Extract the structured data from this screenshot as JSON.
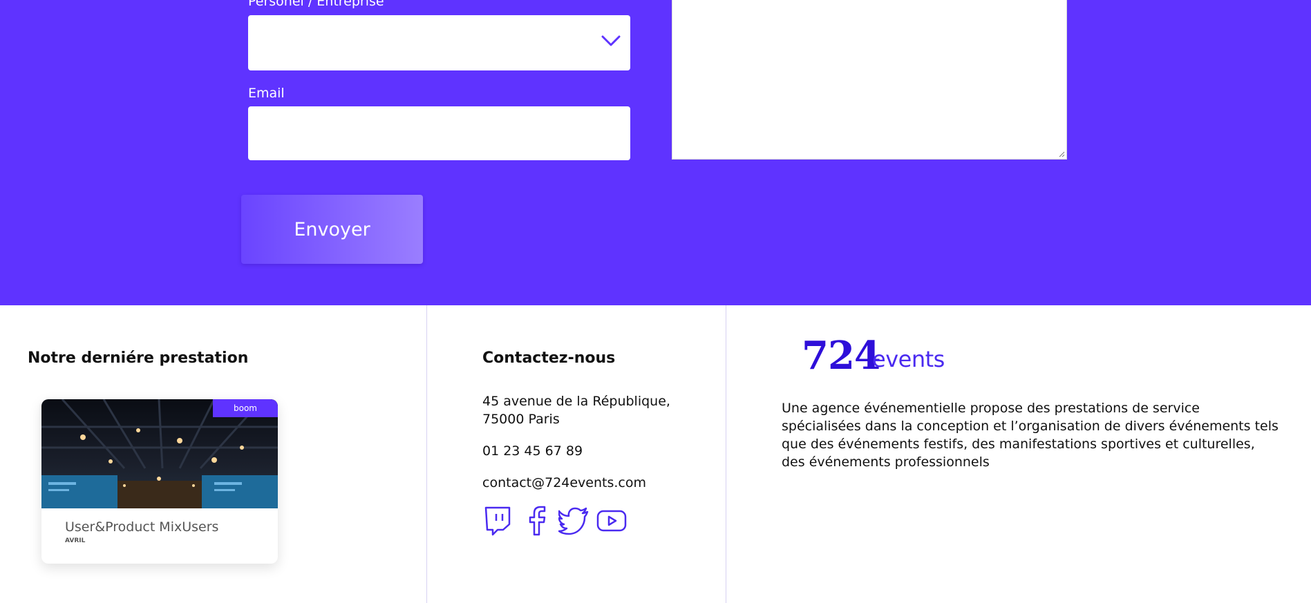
{
  "form": {
    "type_label": "Personel / Entreprise",
    "type_value": "",
    "email_label": "Email",
    "email_value": "",
    "message_value": "",
    "submit_label": "Envoyer"
  },
  "footer": {
    "latest": {
      "title": "Notre derniére prestation",
      "card": {
        "badge": "boom",
        "name": "User&Product MixUsers",
        "month": "AVRIL"
      }
    },
    "contact": {
      "title": "Contactez-nous",
      "address_line1": "45 avenue de la République,",
      "address_line2": "75000 Paris",
      "phone": "01 23 45 67 89",
      "email": "contact@724events.com",
      "social_icons": [
        "twitch-icon",
        "facebook-icon",
        "twitter-icon",
        "youtube-icon"
      ]
    },
    "brand": {
      "number": "724",
      "word": "events",
      "description": "Une agence événementielle propose des prestations de service spécialisées dans la conception et l’organisation de divers événements tels que des événements festifs, des manifestations sportives et culturelles, des événements professionnels"
    }
  },
  "colors": {
    "primary": "#5f33ff",
    "brand": "#2e0fd9",
    "divider": "#d7d1f2"
  }
}
